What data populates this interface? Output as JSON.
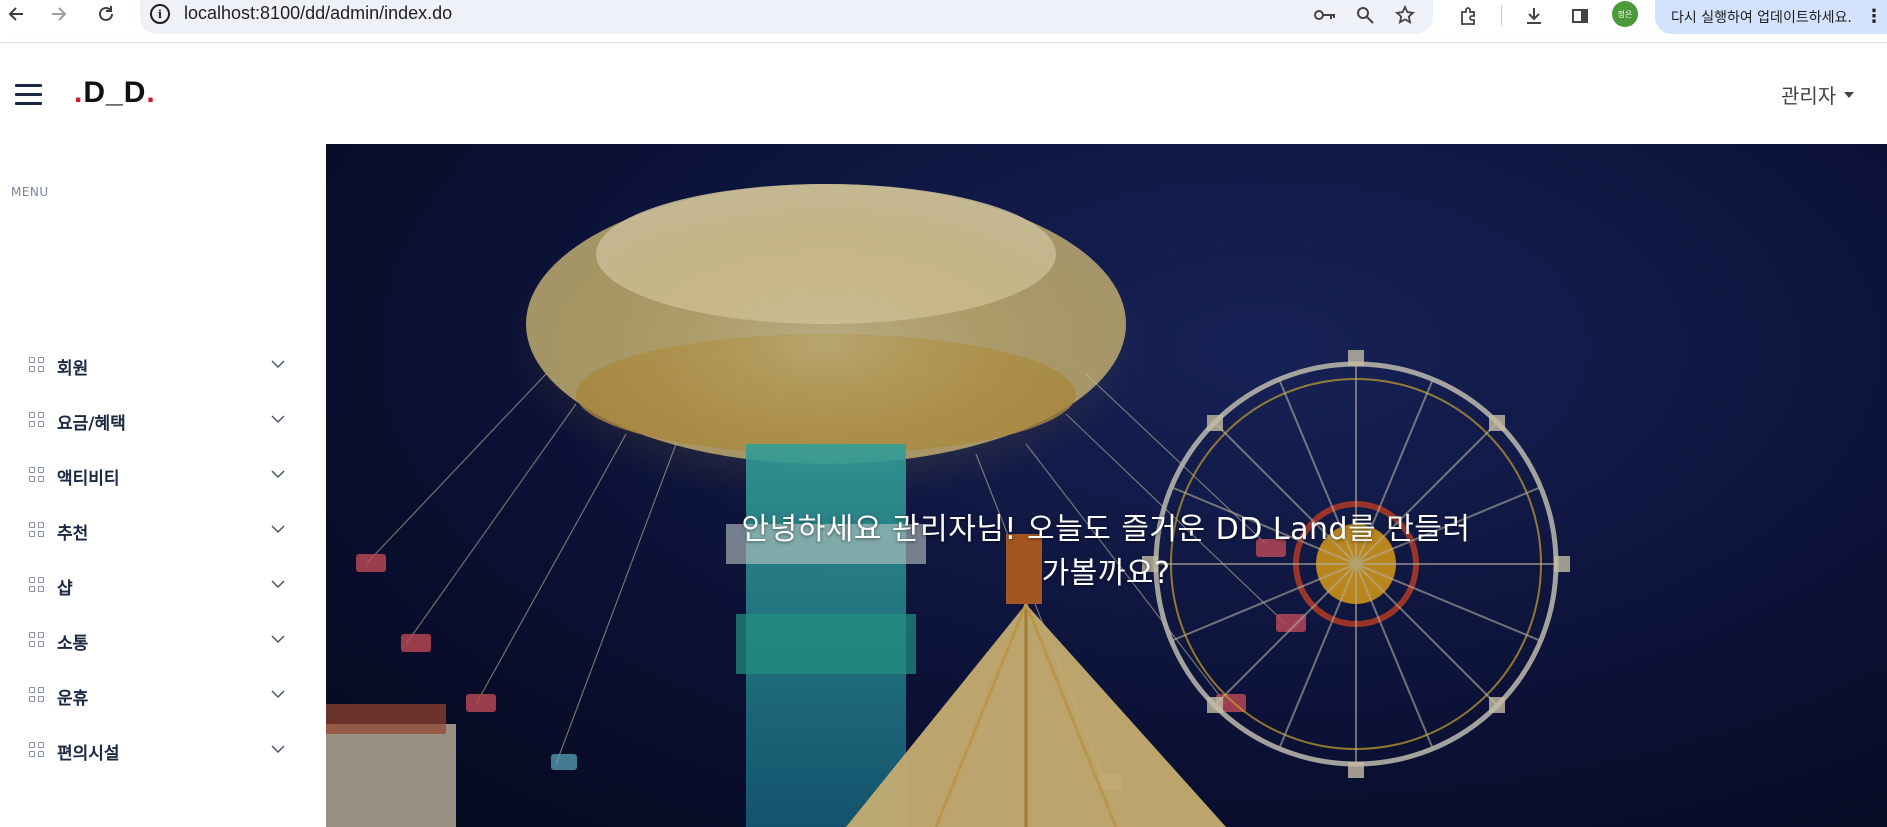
{
  "browser": {
    "url": "localhost:8100/dd/admin/index.do",
    "profile_label": "정은",
    "update_label": "다시 실행하여 업데이트하세요."
  },
  "header": {
    "logo_text": "D_D",
    "admin_label": "관리자"
  },
  "sidebar": {
    "heading": "MENU",
    "items": [
      {
        "label": "회원"
      },
      {
        "label": "요금/혜택"
      },
      {
        "label": "액티비티"
      },
      {
        "label": "추천"
      },
      {
        "label": "샵"
      },
      {
        "label": "소통"
      },
      {
        "label": "운휴"
      },
      {
        "label": "편의시설"
      }
    ]
  },
  "hero": {
    "welcome_line1": "안녕하세요 관리자님! 오늘도 즐거운 DD Land를 만들러",
    "welcome_line2": "가볼까요?"
  }
}
